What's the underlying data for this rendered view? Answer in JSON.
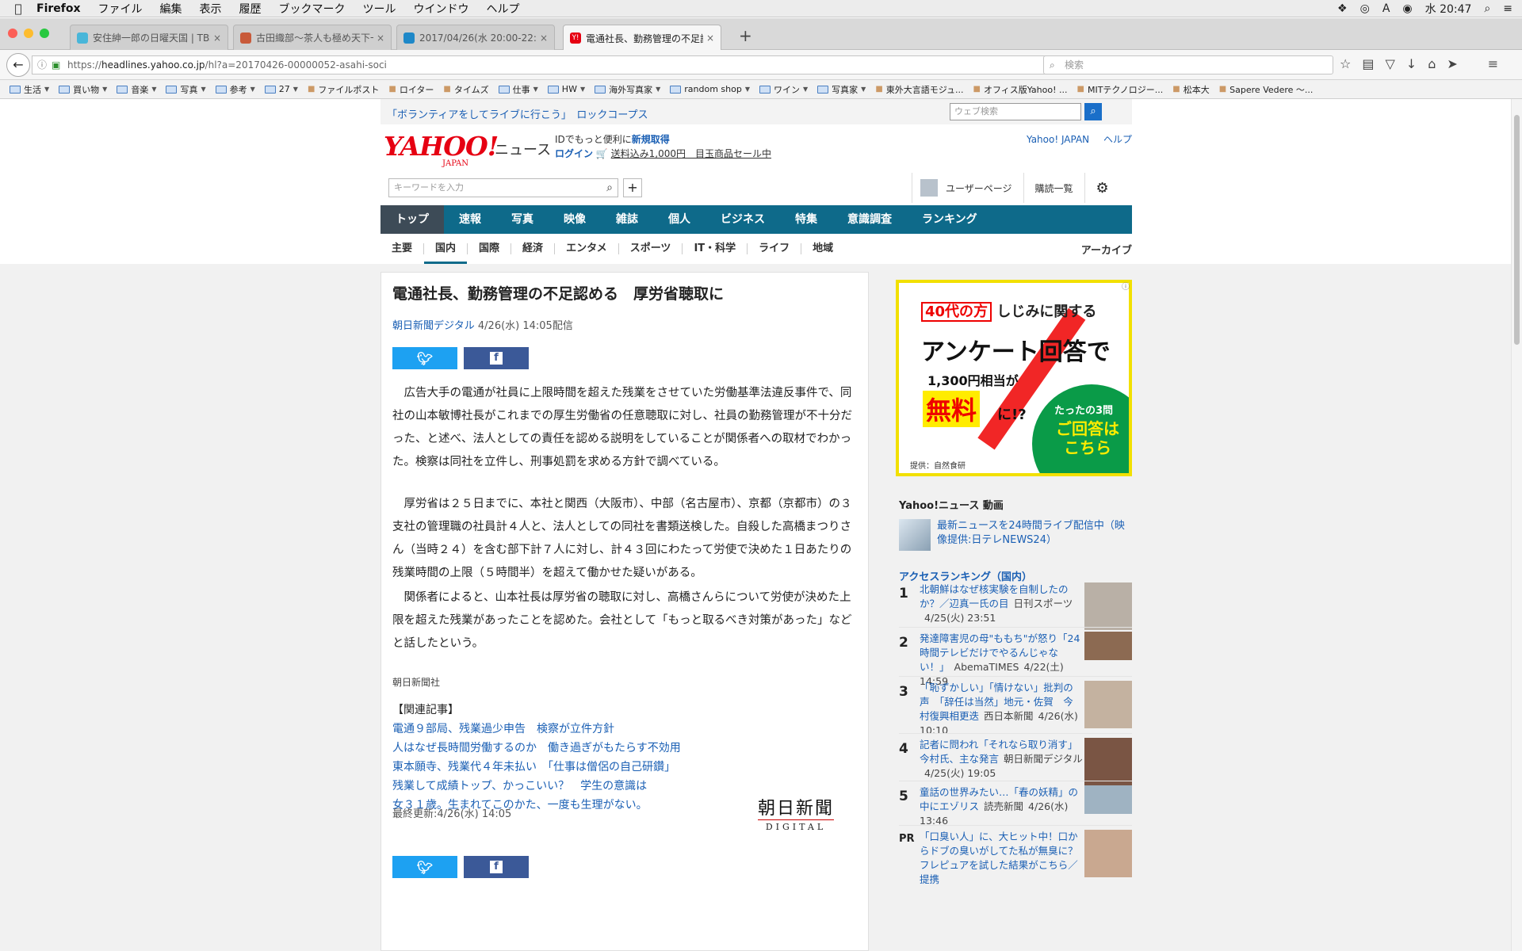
{
  "menubar": {
    "items": [
      "Firefox",
      "ファイル",
      "編集",
      "表示",
      "履歴",
      "ブックマーク",
      "ツール",
      "ウインドウ",
      "ヘルプ"
    ],
    "clock": "水 20:47"
  },
  "tabs": [
    {
      "title": "安住紳一郎の日曜天国 | TBSラ",
      "fav_color": "#49b6d9"
    },
    {
      "title": "古田織部〜茶人も極め天下一の",
      "fav_color": "#c85a3a"
    },
    {
      "title": "2017/04/26(水 20:00-22:00",
      "fav_color": "#1e88c8"
    },
    {
      "title": "電通社長、勤務管理の不足認め",
      "fav_color": "#e60012",
      "fav_text": "Y!"
    }
  ],
  "navbar": {
    "url_prefix": "https://",
    "url_host": "headlines.yahoo.co.jp",
    "url_path": "/hl?a=20170426-00000052-asahi-soci",
    "search_placeholder": "検索"
  },
  "bookmarks": [
    {
      "label": "生活",
      "folder": true
    },
    {
      "label": "買い物",
      "folder": true
    },
    {
      "label": "音楽",
      "folder": true
    },
    {
      "label": "写真",
      "folder": true
    },
    {
      "label": "参考",
      "folder": true
    },
    {
      "label": "27",
      "folder": true
    },
    {
      "label": "ファイルポスト",
      "folder": false
    },
    {
      "label": "ロイター",
      "folder": false
    },
    {
      "label": "タイムズ",
      "folder": false
    },
    {
      "label": "仕事",
      "folder": true
    },
    {
      "label": "HW",
      "folder": true
    },
    {
      "label": "海外写真家",
      "folder": true
    },
    {
      "label": "random shop",
      "folder": true
    },
    {
      "label": "ワイン",
      "folder": true
    },
    {
      "label": "写真家",
      "folder": true
    },
    {
      "label": "東外大言語モジュ...",
      "folder": false
    },
    {
      "label": "オフィス版Yahoo! ...",
      "folder": false
    },
    {
      "label": "MITテクノロジー...",
      "folder": false
    },
    {
      "label": "松本大",
      "folder": false
    },
    {
      "label": "Sapere Vedere 〜...",
      "folder": false
    }
  ],
  "header": {
    "promo": "「ボランティアをしてライブに行こう」　ロックコープス",
    "web_search_placeholder": "ウェブ検索",
    "logo": "YAHOO!",
    "logo_sub": "JAPAN",
    "logo_news": "ニュース",
    "id_line1_a": "IDでもっと便利に",
    "id_line1_b": "新規取得",
    "login": "ログイン",
    "shop_link": "送料込み1,000円　目玉商品セール中",
    "link_yahoo_japan": "Yahoo! JAPAN",
    "link_help": "ヘルプ",
    "keyword_placeholder": "キーワードを入力",
    "user_page": "ユーザーページ",
    "subscriptions": "購読一覧"
  },
  "mainnav": [
    "トップ",
    "速報",
    "写真",
    "映像",
    "雑誌",
    "個人",
    "ビジネス",
    "特集",
    "意識調査",
    "ランキング"
  ],
  "subnav": [
    "主要",
    "国内",
    "国際",
    "経済",
    "エンタメ",
    "スポーツ",
    "IT・科学",
    "ライフ",
    "地域"
  ],
  "subnav_archive": "アーカイブ",
  "article": {
    "title": "電通社長、勤務管理の不足認める　厚労省聴取に",
    "source": "朝日新聞デジタル",
    "date": "4/26(水) 14:05配信",
    "paragraphs": [
      "　広告大手の電通が社員に上限時間を超えた残業をさせていた労働基準法違反事件で、同社の山本敏博社長がこれまでの厚生労働省の任意聴取に対し、社員の勤務管理が不十分だった、と述べ、法人としての責任を認める説明をしていることが関係者への取材でわかった。検察は同社を立件し、刑事処罰を求める方針で調べている。",
      "　厚労省は２５日までに、本社と関西（大阪市）、中部（名古屋市）、京都（京都市）の３支社の管理職の社員計４人と、法人としての同社を書類送検した。自殺した高橋まつりさん（当時２４）を含む部下計７人に対し、計４３回にわたって労使で決めた１日あたりの残業時間の上限（５時間半）を超えて働かせた疑いがある。",
      "　関係者によると、山本社長は厚労省の聴取に対し、高橋さんらについて労使が決めた上限を超えた残業があったことを認めた。会社として「もっと取るべき対策があった」などと話したという。"
    ],
    "credit": "朝日新聞社",
    "related_heading": "【関連記事】",
    "related": [
      "電通９部局、残業過少申告　検察が立件方針",
      "人はなぜ長時間労働するのか　働き過ぎがもたらす不効用",
      "東本願寺、残業代４年未払い　「仕事は僧侶の自己研鑽」",
      "残業して成績トップ、かっこいい？　学生の意識は",
      "女３１歳。生まれてこのかた、一度も生理がない。"
    ],
    "updated": "最終更新:4/26(水) 14:05",
    "publisher_logo": "朝日新聞",
    "publisher_logo_sub": "DIGITAL"
  },
  "ad": {
    "age": "40代の方",
    "line1": "しじみに関する",
    "line2": "アンケート回答で",
    "line3": "1,300円相当が",
    "free": "無料",
    "free_suffix": "に!?",
    "badge1": "たったの3問",
    "badge2": "ご回答は",
    "badge3": "こちら",
    "provider": "提供：自然食研"
  },
  "sidebar": {
    "video_heading": "Yahoo!ニュース 動画",
    "video_link": "最新ニュースを24時間ライブ配信中（映像提供:日テレNEWS24）",
    "ranking_heading": "アクセスランキング（国内）",
    "ranking": [
      {
        "num": "1",
        "title": "北朝鮮はなぜ核実験を自制したのか？／辺真一氏の目",
        "meta": "日刊スポーツ",
        "date": "4/25(火) 23:51"
      },
      {
        "num": "2",
        "title": "発達障害児の母\"ももち\"が怒り「24時間テレビだけでやるんじゃない！」",
        "meta": "AbemaTIMES",
        "date": "4/22(土) 14:59"
      },
      {
        "num": "3",
        "title": "「恥ずかしい」「情けない」批判の声　「辞任は当然」地元・佐賀　今村復興相更迭",
        "meta": "西日本新聞",
        "date": "4/26(水) 10:10"
      },
      {
        "num": "4",
        "title": "記者に問われ「それなら取り消す」　今村氏、主な発言",
        "meta": "朝日新聞デジタル",
        "date": "4/25(火) 19:05"
      },
      {
        "num": "5",
        "title": "童話の世界みたい…「春の妖精」の中にエゾリス",
        "meta": "読売新聞",
        "date": "4/26(水) 13:46"
      },
      {
        "num": "PR",
        "title": "「口臭い人」に、大ヒット中！口からドブの臭いがしてた私が無臭に？フレピュアを試した結果がこちら／提携",
        "meta": "",
        "date": ""
      }
    ]
  }
}
